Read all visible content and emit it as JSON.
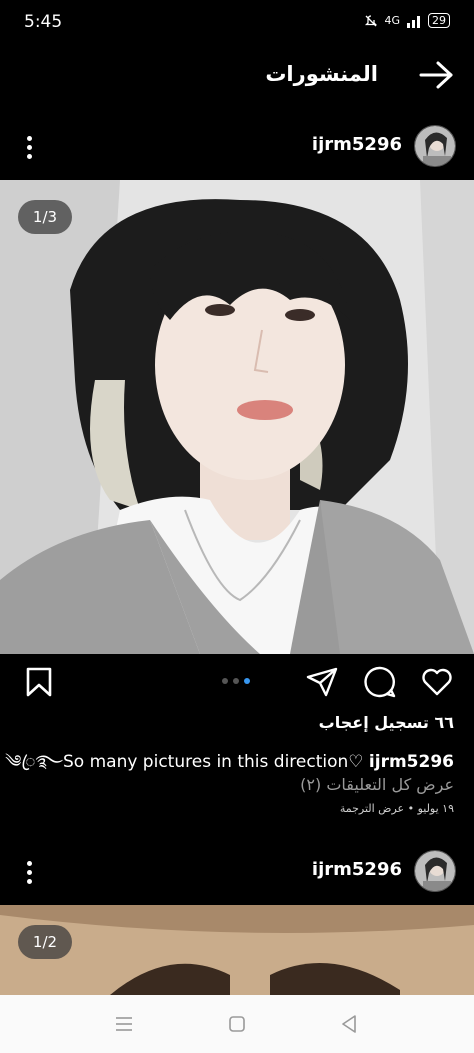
{
  "status_bar": {
    "time": "5:45",
    "network": "4G",
    "battery": "29"
  },
  "header": {
    "title": "المنشورات"
  },
  "posts": [
    {
      "username": "ijrm5296",
      "image_counter": "1/3",
      "likes": "٦٦ تسجيل إعجاب",
      "caption_username": "ijrm5296",
      "caption_text": "So many pictures in this direction♡",
      "caption_decoration": "༄ꦿ࿐",
      "view_comments": "عرض كل التعليقات (٢)",
      "meta": "١٩ يوليو • عرض الترجمة"
    },
    {
      "username": "ijrm5296",
      "image_counter": "1/2"
    }
  ],
  "colors": {
    "accent": "#3897f0",
    "background": "#000000"
  }
}
